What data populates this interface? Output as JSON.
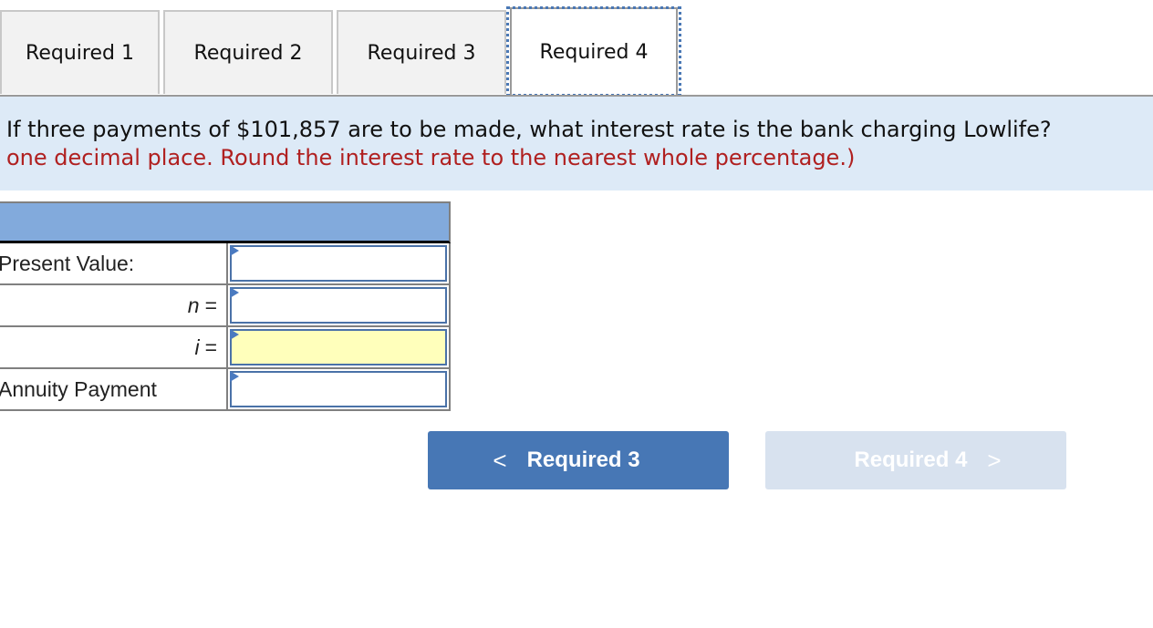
{
  "tabs": [
    {
      "label": "Required 1",
      "active": false
    },
    {
      "label": "Required 2",
      "active": false
    },
    {
      "label": "Required 3",
      "active": false
    },
    {
      "label": "Required 4",
      "active": true
    }
  ],
  "question": {
    "text": "If three payments of $101,857 are to be made, what interest rate is the bank charging Lowlife?",
    "instruction": "one decimal place. Round the interest rate to the nearest whole percentage.)"
  },
  "table": {
    "rows": [
      {
        "label": "Present Value:",
        "value": "",
        "placeholder": ""
      },
      {
        "label_var": "n",
        "label_eq": "=",
        "value": "",
        "placeholder": ""
      },
      {
        "label_var": "i",
        "label_eq": "=",
        "value": "",
        "placeholder": "",
        "highlighted": true
      },
      {
        "label": "Annuity Payment",
        "value": "",
        "placeholder": ""
      }
    ]
  },
  "nav": {
    "prev_label": "Required 3",
    "prev_icon": "chevron-left-icon",
    "prev_glyph": "<",
    "next_label": "Required 4",
    "next_icon": "chevron-right-icon",
    "next_glyph": ">"
  },
  "colors": {
    "accent": "#4777b5",
    "question_bg": "#ddeaf7",
    "instruction_red": "#b02020",
    "table_header": "#82aadc",
    "highlight_input": "#ffffbb",
    "disabled_button": "#d8e2ef"
  }
}
